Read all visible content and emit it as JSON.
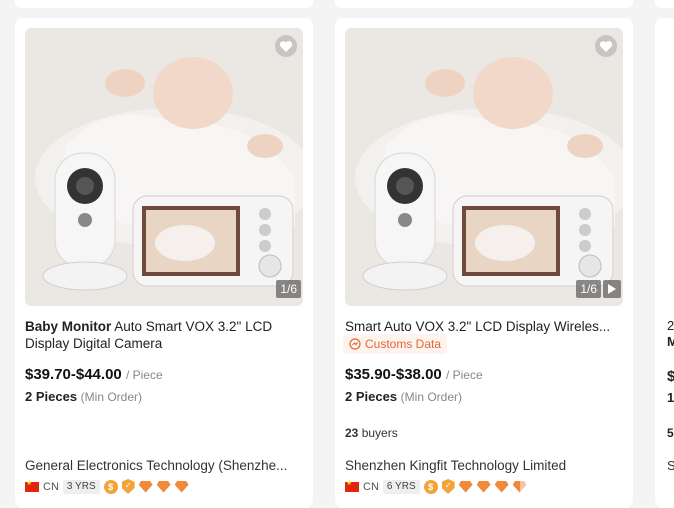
{
  "cards": [
    {
      "title_bold": "Baby Monitor",
      "title_rest": " Auto Smart VOX 3.2\" LCD Display Digital Camera",
      "img_counter": "1/6",
      "price": "$39.70-$44.00",
      "price_unit": "/ Piece",
      "moq": "2 Pieces",
      "moq_note": "(Min Order)",
      "supplier": "General Electronics Technology (Shenzhe...",
      "country": "CN",
      "years": "3 YRS"
    },
    {
      "title": "Smart Auto VOX 3.2\" LCD Display Wireles...",
      "customs_label": "Customs Data",
      "img_counter": "1/6",
      "price": "$35.90-$38.00",
      "price_unit": "/ Piece",
      "moq": "2 Pieces",
      "moq_note": "(Min Order)",
      "buyers_count": "23",
      "buyers_label": "buyers",
      "supplier": "Shenzhen Kingfit Technology Limited",
      "country": "CN",
      "years": "6 YRS"
    }
  ],
  "card3_fragments": [
    "2",
    "M",
    "$",
    "1",
    "5",
    "S"
  ],
  "icons": {
    "favorite": "heart-icon",
    "video": "play-icon",
    "customs": "customs-icon",
    "flag": "cn-flag-icon",
    "gold_supplier": "coin-icon",
    "verified": "shield-icon",
    "rating": "diamond-icon"
  },
  "colors": {
    "accent_orange": "#f08a3a",
    "customs_text": "#e0673a",
    "customs_bg": "#fff3ee"
  }
}
